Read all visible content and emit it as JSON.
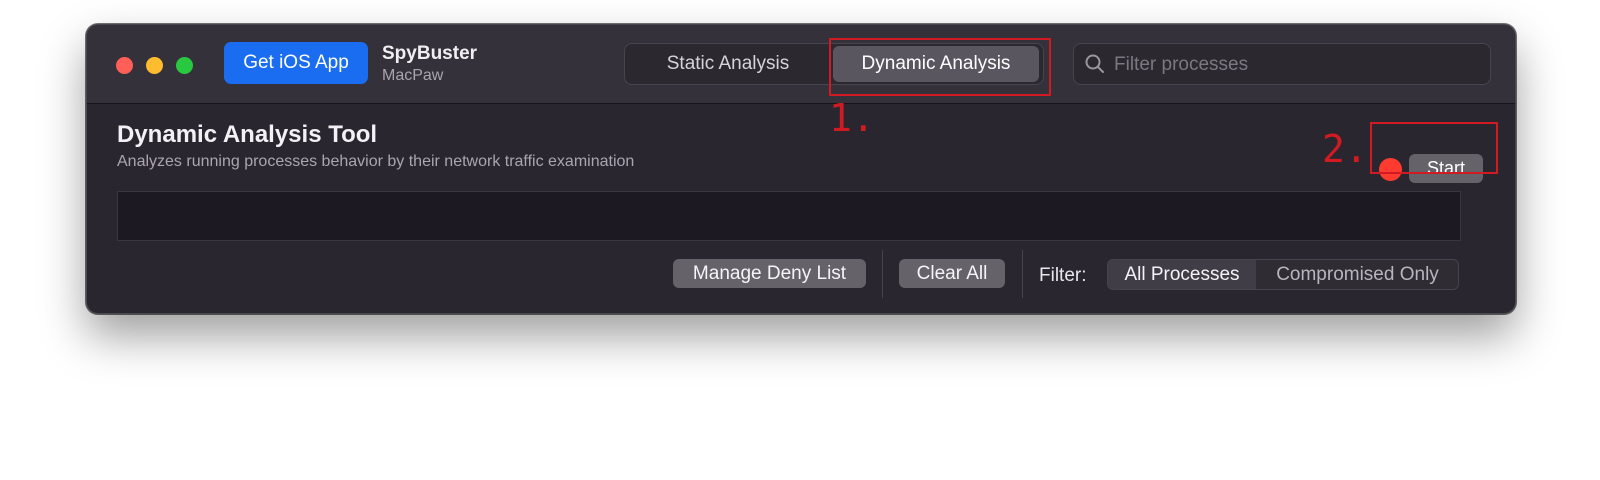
{
  "titlebar": {
    "ios_button": "Get iOS App",
    "app_name": "SpyBuster",
    "app_vendor": "MacPaw"
  },
  "tabs": [
    {
      "label": "Static Analysis",
      "selected": false
    },
    {
      "label": "Dynamic Analysis",
      "selected": true
    }
  ],
  "search": {
    "placeholder": "Filter processes",
    "value": ""
  },
  "annotations": {
    "step1": "1.",
    "step2": "2."
  },
  "tool": {
    "title": "Dynamic Analysis Tool",
    "description": "Analyzes running processes behavior by their network traffic examination",
    "start_label": "Start",
    "status_color": "#ff3b30"
  },
  "footer": {
    "manage_deny_list": "Manage Deny List",
    "clear_all": "Clear All",
    "filter_label": "Filter:",
    "filter_options": [
      {
        "label": "All Processes",
        "selected": true
      },
      {
        "label": "Compromised Only",
        "selected": false
      }
    ]
  },
  "colors": {
    "accent": "#1a6cf0",
    "annotation": "#d11a22",
    "window_bg": "#2a2630"
  }
}
